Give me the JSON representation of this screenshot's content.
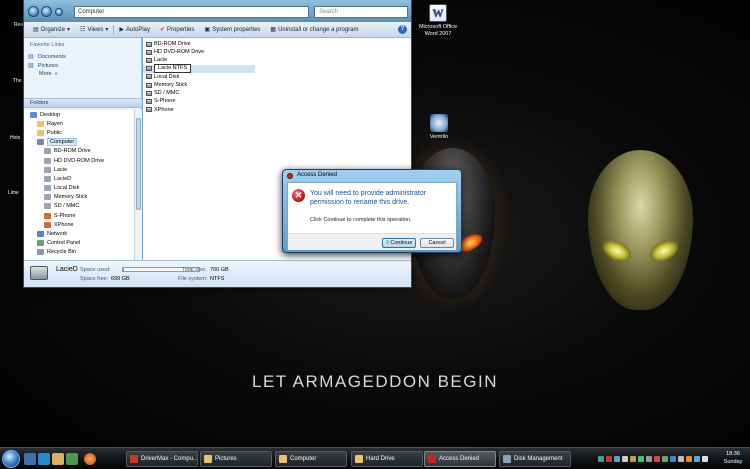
{
  "desktop": {
    "word_icon_label_1": "Microsoft Office",
    "word_icon_label_2": "Word 2007",
    "ventrilo_label": "Ventrilo",
    "slogan": "LET ARMAGEDDON BEGIN",
    "edge_labels": [
      "Rea",
      "The",
      "Hots",
      "Lime"
    ]
  },
  "explorer": {
    "address": "Computer",
    "search_placeholder": "Search",
    "toolbar": {
      "organize": "Organize",
      "views": "Views",
      "autoplay": "AutoPlay",
      "properties": "Properties",
      "system_properties": "System properties",
      "uninstall": "Uninstall or change a program"
    },
    "favorite_links_title": "Favorite Links",
    "favorites": [
      "Documents",
      "Pictures",
      "More"
    ],
    "folders_title": "Folders",
    "tree": [
      {
        "label": "Desktop",
        "icon": "desktop-icon",
        "color": "#5c8fd6",
        "indent": 0
      },
      {
        "label": "Rayen",
        "icon": "user-folder-icon",
        "color": "#e9c86b",
        "indent": 1
      },
      {
        "label": "Public",
        "icon": "folder-icon",
        "color": "#e9c86b",
        "indent": 1
      },
      {
        "label": "Computer",
        "icon": "computer-icon",
        "color": "#7a8a9c",
        "indent": 1,
        "selected": true
      },
      {
        "label": "BD-ROM Drive",
        "icon": "optical-drive-icon",
        "color": "#9aa5b1",
        "indent": 2
      },
      {
        "label": "HD DVD-ROM Drive",
        "icon": "optical-drive-icon",
        "color": "#9aa5b1",
        "indent": 2
      },
      {
        "label": "Lacie",
        "icon": "drive-icon",
        "color": "#9aa5b1",
        "indent": 2
      },
      {
        "label": "LacieD",
        "icon": "drive-icon",
        "color": "#9aa5b1",
        "indent": 2
      },
      {
        "label": "Local Disk",
        "icon": "drive-icon",
        "color": "#9aa5b1",
        "indent": 2
      },
      {
        "label": "Memory Stick",
        "icon": "card-reader-icon",
        "color": "#9aa5b1",
        "indent": 2
      },
      {
        "label": "SD / MMC",
        "icon": "card-reader-icon",
        "color": "#9aa5b1",
        "indent": 2
      },
      {
        "label": "S-Phone",
        "icon": "phone-icon",
        "color": "#d86a2b",
        "indent": 2
      },
      {
        "label": "XPhone",
        "icon": "phone-icon",
        "color": "#d86a2b",
        "indent": 2
      },
      {
        "label": "Network",
        "icon": "network-icon",
        "color": "#4d8ad0",
        "indent": 1
      },
      {
        "label": "Control Panel",
        "icon": "control-panel-icon",
        "color": "#6aa36a",
        "indent": 1
      },
      {
        "label": "Recycle Bin",
        "icon": "recycle-bin-icon",
        "color": "#8a99a8",
        "indent": 1
      }
    ],
    "drives": [
      {
        "label": "BD-ROM Drive"
      },
      {
        "label": "HD DVD-ROM Drive"
      },
      {
        "label": "Lacie"
      },
      {
        "label": "Lacie NTFS",
        "renaming": true
      },
      {
        "label": "Local Disk"
      },
      {
        "label": "Memory Stick"
      },
      {
        "label": "SD / MMC"
      },
      {
        "label": "S-Phone"
      },
      {
        "label": "XPhone"
      }
    ],
    "details": {
      "name": "LacieD",
      "space_used_label": "Space used:",
      "space_free_label": "Space free:",
      "space_free": "699 GB",
      "total_size_label": "Total size:",
      "total_size": "700 GB",
      "file_system_label": "File system:",
      "file_system": "NTFS",
      "usage_fraction": 0.01
    }
  },
  "dialog": {
    "title": "Access Denied",
    "message": "You will need to provide administrator permission to rename this drive.",
    "subtext": "Click Continue to complete this operation.",
    "continue_label": "Continue",
    "cancel_label": "Cancel"
  },
  "taskbar": {
    "buttons": [
      {
        "label": "DriverMax - Compu...",
        "color": "#c43b2a"
      },
      {
        "label": "Pictures",
        "color": "#e6c566"
      },
      {
        "label": "Computer",
        "color": "#e6c566"
      },
      {
        "label": "Hard Drive",
        "color": "#e6c566"
      },
      {
        "label": "Access Denied",
        "color": "#c22",
        "active": true
      },
      {
        "label": "Disk Management",
        "color": "#8aa2bd"
      }
    ],
    "clock_time": "18:36",
    "clock_day": "Sunday"
  },
  "colors": {
    "accent_blue": "#2b66b8",
    "error_red": "#c31515",
    "dialog_text": "#1f4e9c"
  }
}
